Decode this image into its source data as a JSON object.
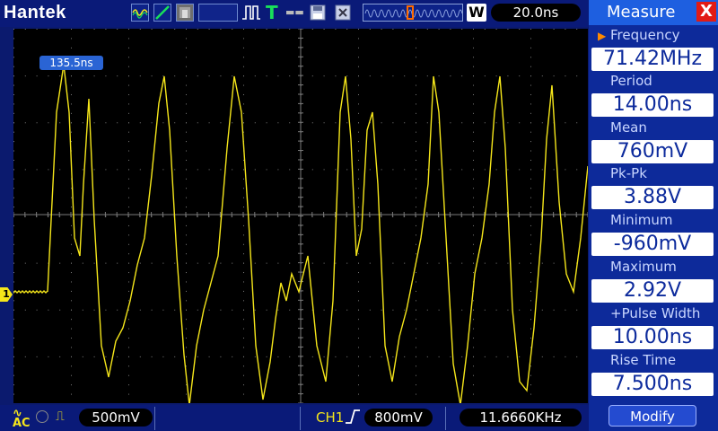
{
  "app": {
    "brand": "Hantek"
  },
  "toolbar": {
    "icons": [
      "waveform-icon",
      "slope-icon",
      "gray-icon",
      "pulse-icon",
      "trigger-T-icon",
      "save-icon",
      "close-icon"
    ],
    "mode_letter": "W",
    "timebase": "20.0ns"
  },
  "scope": {
    "trigger_position": "135.5ns",
    "channel_marker": "1",
    "trace_color": "#f5e61a",
    "grid_color": "#7a7a7a"
  },
  "measure": {
    "title": "Measure",
    "close": "X",
    "items": [
      {
        "label": "Frequency",
        "value": "71.42MHz"
      },
      {
        "label": "Period",
        "value": "14.00ns"
      },
      {
        "label": "Mean",
        "value": "760mV"
      },
      {
        "label": "Pk-Pk",
        "value": "3.88V"
      },
      {
        "label": "Minimum",
        "value": "-960mV"
      },
      {
        "label": "Maximum",
        "value": "2.92V"
      },
      {
        "label": "+Pulse Width",
        "value": "10.00ns"
      },
      {
        "label": "Rise Time",
        "value": "7.500ns"
      }
    ],
    "modify": "Modify"
  },
  "bottom": {
    "coupling": "AC",
    "volts_div": "500mV",
    "trigger_source": "CH1",
    "trigger_level": "800mV",
    "frequency_counter": "11.6660KHz"
  },
  "colors": {
    "accent": "#1e5fe0",
    "panel": "#0d2a9a",
    "close_red": "#e21b14",
    "trace": "#f5e61a"
  }
}
